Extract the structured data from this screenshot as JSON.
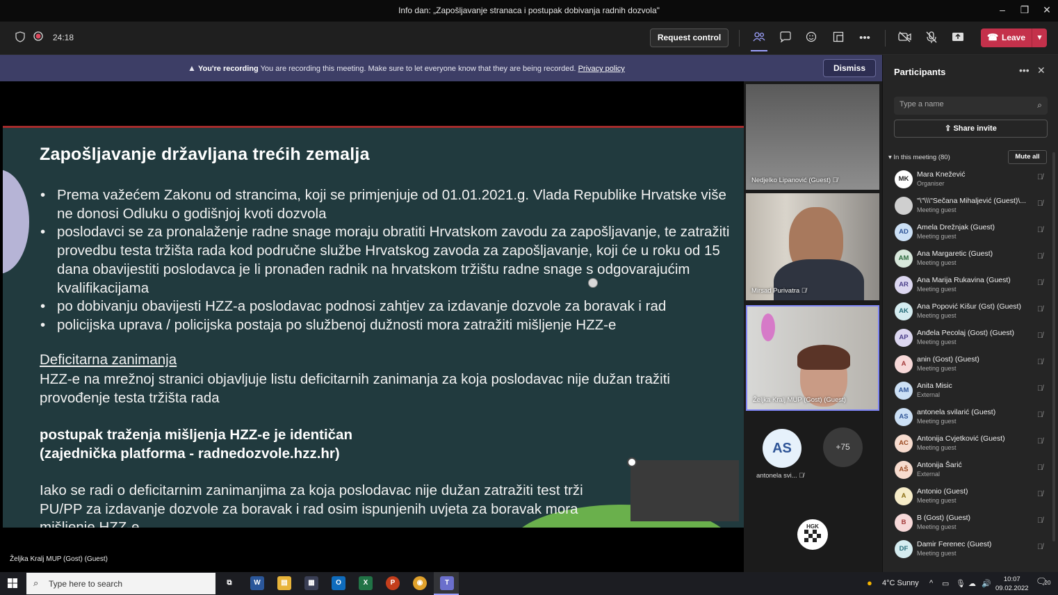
{
  "window": {
    "title": "Info dan: „Zapošljavanje stranaca i postupak dobivanja radnih dozvola\""
  },
  "toolbar": {
    "timer": "24:18",
    "request_control": "Request control",
    "leave": "Leave"
  },
  "banner": {
    "bold": "You're recording",
    "text": "You are recording this meeting. Make sure to let everyone know that they are being recorded.",
    "link": "Privacy policy",
    "dismiss": "Dismiss"
  },
  "slide": {
    "title": "Zapošljavanje državljana trećih zemalja",
    "bullets": [
      "Prema važećem Zakonu od strancima, koji se primjenjuje od 01.01.2021.g. Vlada Republike Hrvatske više ne donosi Odluku o godišnjoj kvoti dozvola",
      "poslodavci se za pronalaženje radne snage moraju obratiti Hrvatskom zavodu za zapošljavanje, te zatražiti provedbu testa tržišta rada kod područne službe Hrvatskog zavoda za zapošljavanje, koji će u roku od 15 dana obavijestiti poslodavca je li pronađen radnik na hrvatskom tržištu radne snage s odgovarajućim kvalifikacijama",
      "po dobivanju obavijesti HZZ-a poslodavac podnosi zahtjev za izdavanje dozvole za boravak i rad",
      "policijska uprava / policijska postaja po službenoj dužnosti mora zatražiti mišljenje HZZ-e"
    ],
    "subheading": "Deficitarna zanimanja",
    "paragraph": "HZZ-e na mrežnoj stranici objavljuje listu deficitarnih zanimanja za koja poslodavac nije dužan tražiti provođenje testa tržišta rada",
    "bold_line1": "postupak traženja mišljenja HZZ-e je identičan",
    "bold_line2": "(zajednička platforma -  radnedozvole.hzz.hr)",
    "last_line1": "Iako se radi o deficitarnim zanimanjima za koja poslodavac nije dužan zatražiti test trži",
    "last_line2": "PU/PP za izdavanje dozvole za boravak i rad osim ispunjenih uvjeta za boravak mora",
    "last_line3": "mišljenje HZZ-e"
  },
  "presenter_name": "Željka Kralj MUP (Gost) (Guest)",
  "videos": [
    {
      "name": "Nedjelko Lipanović (Guest)"
    },
    {
      "name": "Mirsad Purivatra"
    },
    {
      "name": "Željka Kralj MUP (Gost) (Guest)"
    }
  ],
  "overflow": {
    "initials": "AS",
    "name": "antonela svi...",
    "more": "+75",
    "logo": "HGK"
  },
  "participants": {
    "title": "Participants",
    "search_placeholder": "Type a name",
    "share_invite": "Share invite",
    "in_meeting": "In this meeting (80)",
    "mute_all": "Mute all",
    "list": [
      {
        "initials": "MK",
        "name": "Mara Knežević",
        "role": "Organiser",
        "color": "#ffffff",
        "fg": "#222222"
      },
      {
        "initials": "",
        "name": "\"\\\"\\\\\\\"Sečana Mihaljević (Guest)\\...",
        "role": "Meeting guest",
        "color": "#cfcfcf",
        "fg": "#555555"
      },
      {
        "initials": "AD",
        "name": "Amela Drežnjak (Guest)",
        "role": "Meeting guest",
        "color": "#cce0f5",
        "fg": "#2f5597"
      },
      {
        "initials": "AM",
        "name": "Ana Margaretic (Guest)",
        "role": "Meeting guest",
        "color": "#d8e8dc",
        "fg": "#2e6b3f"
      },
      {
        "initials": "AR",
        "name": "Ana Marija Rukavina (Guest)",
        "role": "Meeting guest",
        "color": "#dcd7f0",
        "fg": "#4b3f8a"
      },
      {
        "initials": "AK",
        "name": "Ana Popović Kišur (Gst) (Guest)",
        "role": "Meeting guest",
        "color": "#d5ecf0",
        "fg": "#256b78"
      },
      {
        "initials": "AP",
        "name": "Anđela Pecolaj (Gost) (Guest)",
        "role": "Meeting guest",
        "color": "#dcd7f0",
        "fg": "#4b3f8a"
      },
      {
        "initials": "A",
        "name": "anin (Gost) (Guest)",
        "role": "Meeting guest",
        "color": "#f7d9d9",
        "fg": "#a33a3a"
      },
      {
        "initials": "AM",
        "name": "Anita Misic",
        "role": "External",
        "color": "#cce0f5",
        "fg": "#2f5597"
      },
      {
        "initials": "AS",
        "name": "antonela svilarić (Guest)",
        "role": "Meeting guest",
        "color": "#cce0f5",
        "fg": "#2f5597"
      },
      {
        "initials": "AC",
        "name": "Antonija Cvjetković (Guest)",
        "role": "Meeting guest",
        "color": "#f7dccf",
        "fg": "#9a4a22"
      },
      {
        "initials": "AŠ",
        "name": "Antonija Šarić",
        "role": "External",
        "color": "#f7dccf",
        "fg": "#9a4a22"
      },
      {
        "initials": "A",
        "name": "Antonio (Guest)",
        "role": "Meeting guest",
        "color": "#f6ecc8",
        "fg": "#8a6d12"
      },
      {
        "initials": "B",
        "name": "B (Gost) (Guest)",
        "role": "Meeting guest",
        "color": "#f7d9d9",
        "fg": "#a33a3a"
      },
      {
        "initials": "DF",
        "name": "Damir Ferenec (Guest)",
        "role": "Meeting guest",
        "color": "#d5ecf0",
        "fg": "#256b78"
      }
    ]
  },
  "taskbar": {
    "search_placeholder": "Type here to search",
    "weather": "4°C  Sunny",
    "time": "10:07",
    "date": "09.02.2022",
    "notifications": "20"
  }
}
